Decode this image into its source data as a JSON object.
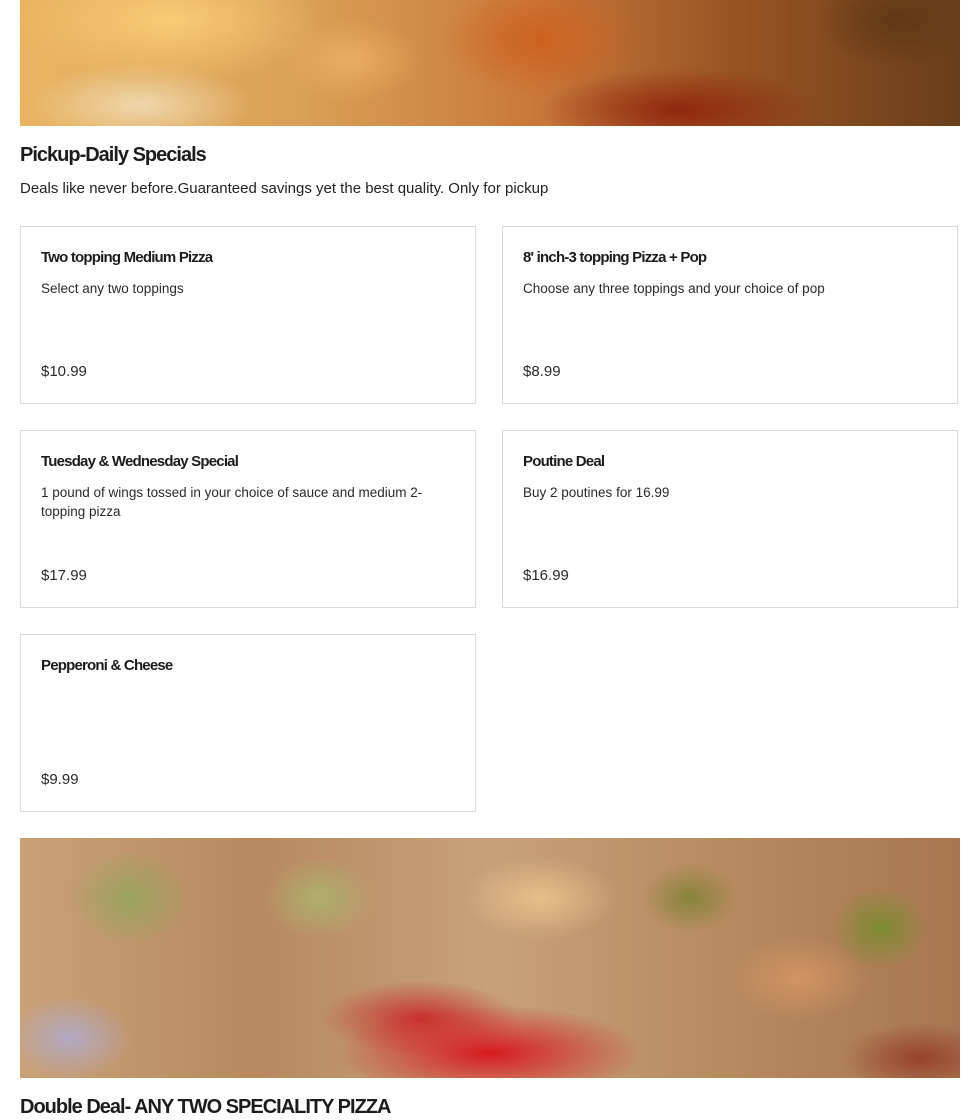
{
  "section_daily": {
    "title": "Pickup-Daily Specials",
    "description": "Deals like never before.Guaranteed savings yet the best quality. Only for pickup"
  },
  "items": [
    {
      "name": "Two topping Medium Pizza",
      "description": "Select any two toppings",
      "price": "$10.99"
    },
    {
      "name": "8' inch-3 topping Pizza + Pop",
      "description": "Choose any three toppings and your choice of pop",
      "price": "$8.99"
    },
    {
      "name": "Tuesday & Wednesday Special",
      "description": "1 pound of wings tossed in your choice of sauce and medium 2-topping pizza",
      "price": "$17.99"
    },
    {
      "name": "Poutine Deal",
      "description": "Buy 2 poutines for 16.99",
      "price": "$16.99"
    },
    {
      "name": "Pepperoni & Cheese",
      "description": "",
      "price": "$9.99"
    }
  ],
  "section_double": {
    "title": "Double Deal- ANY TWO SPECIALITY PIZZA"
  }
}
